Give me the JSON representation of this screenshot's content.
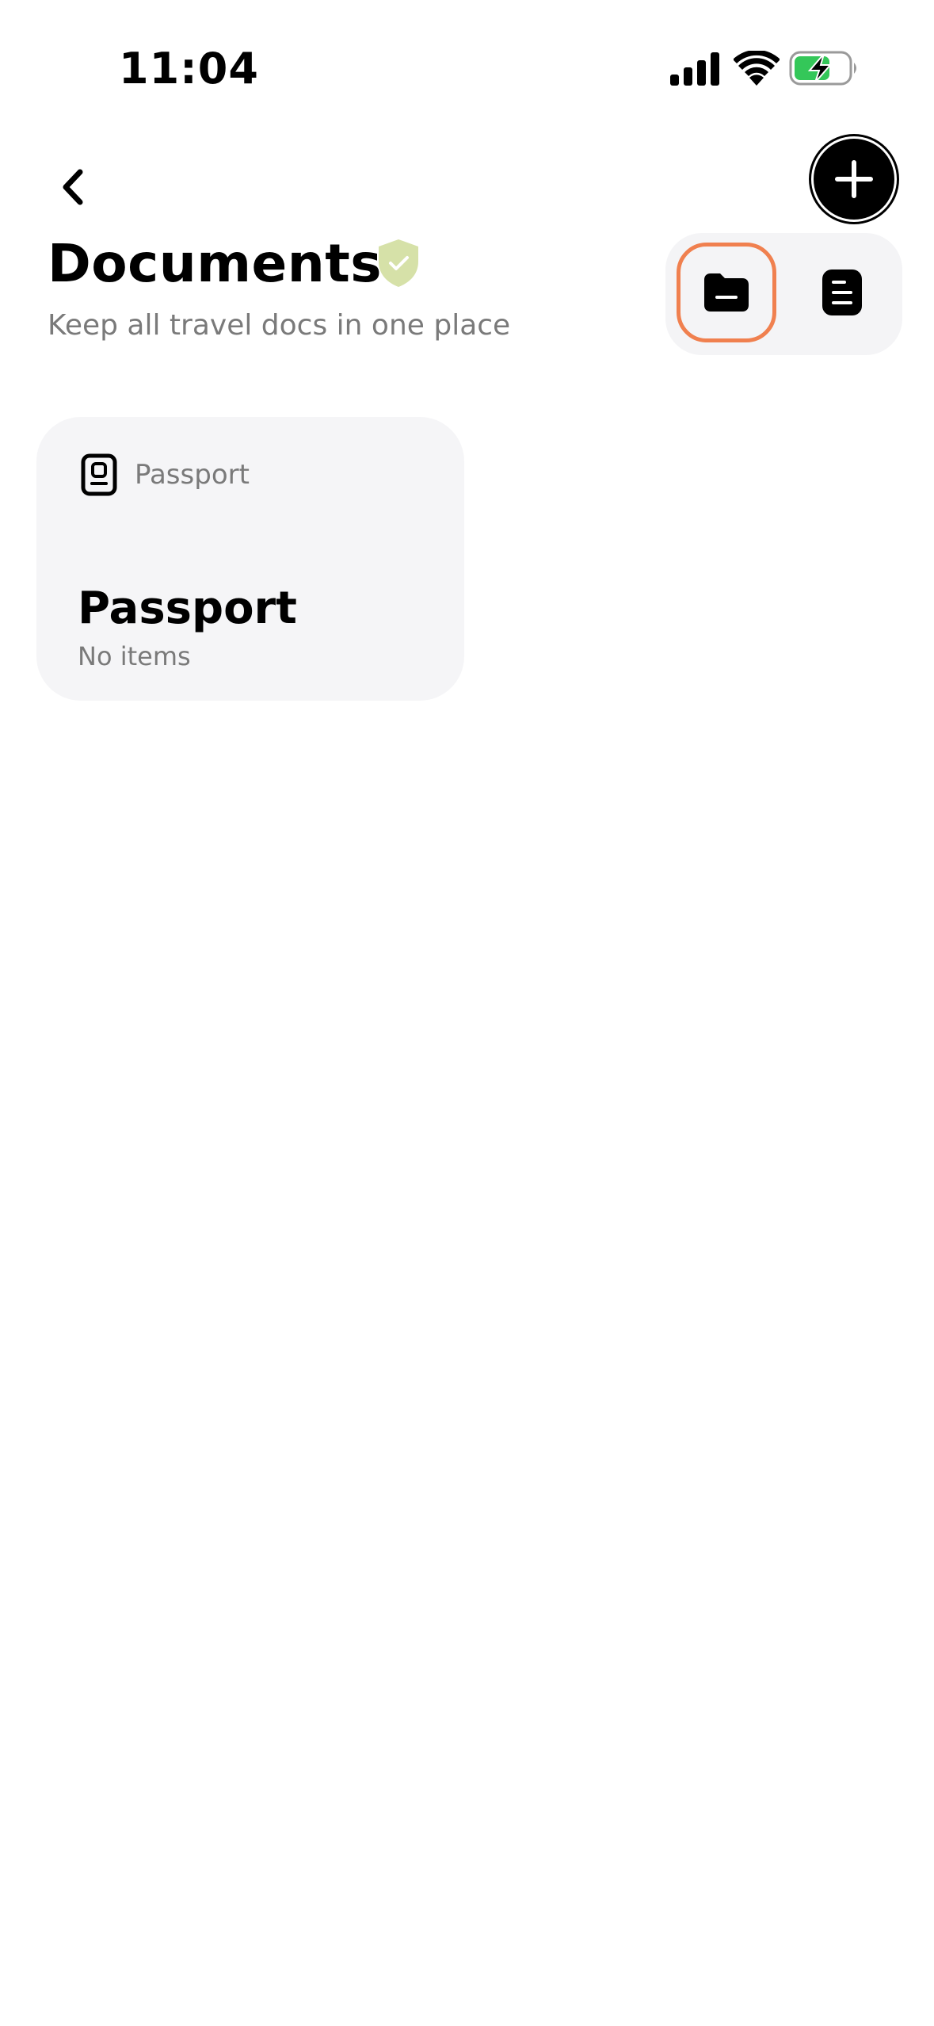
{
  "status_bar": {
    "time": "11:04",
    "icons": [
      "cellular-signal-icon",
      "wifi-icon",
      "battery-charging-icon"
    ]
  },
  "header": {
    "back_icon": "chevron-left-icon",
    "add_icon": "plus-icon",
    "title": "Documents",
    "title_badge_icon": "shield-check-icon",
    "subtitle": "Keep all travel docs in one place"
  },
  "view_toggle": {
    "options": [
      {
        "icon": "folder-icon",
        "selected": true
      },
      {
        "icon": "document-list-icon",
        "selected": false
      }
    ],
    "selected_outline_color": "#f0804f"
  },
  "documents": [
    {
      "tag": "Passport",
      "tag_icon": "passport-icon",
      "title": "Passport",
      "subtitle": "No items"
    }
  ],
  "colors": {
    "accent": "#f0804f",
    "badge": "#d6e1a8",
    "card_background": "#f5f5f7",
    "secondary_text": "#7a7a7a",
    "battery_fill": "#34c759"
  }
}
